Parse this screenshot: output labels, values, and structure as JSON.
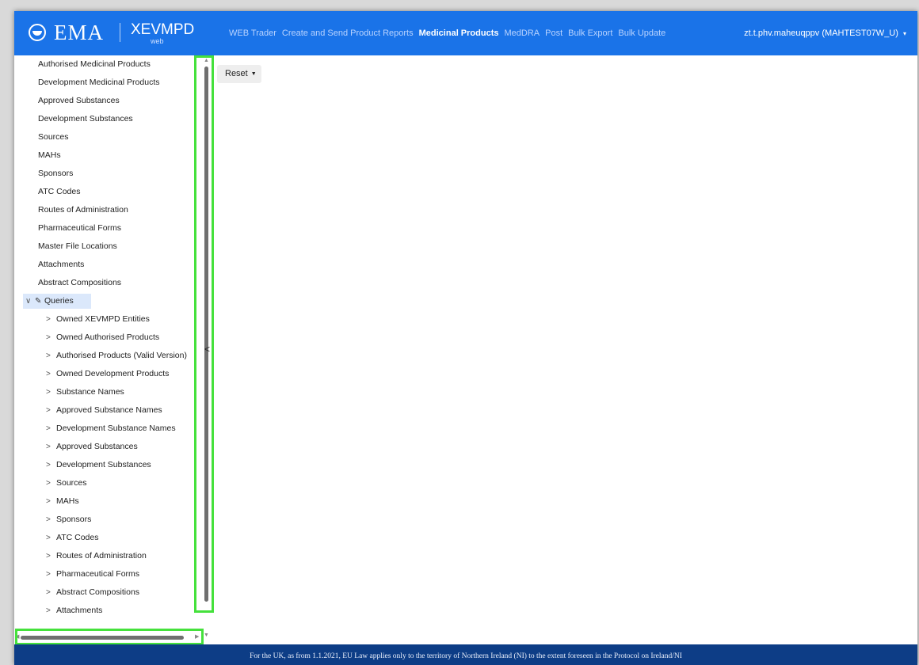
{
  "header": {
    "logo_text": "EMA",
    "app_name": "XEVMPD",
    "app_sub": "web",
    "nav": [
      {
        "label": "WEB Trader",
        "active": false
      },
      {
        "label": "Create and Send Product Reports",
        "active": false
      },
      {
        "label": "Medicinal Products",
        "active": true
      },
      {
        "label": "MedDRA",
        "active": false
      },
      {
        "label": "Post",
        "active": false
      },
      {
        "label": "Bulk Export",
        "active": false
      },
      {
        "label": "Bulk Update",
        "active": false
      }
    ],
    "user": "zt.t.phv.maheuqppv (MAHTEST07W_U)",
    "user_caret": "▾"
  },
  "sidebar": {
    "top_items": [
      "Authorised Medicinal Products",
      "Development Medicinal Products",
      "Approved Substances",
      "Development Substances",
      "Sources",
      "MAHs",
      "Sponsors",
      "ATC Codes",
      "Routes of Administration",
      "Pharmaceutical Forms",
      "Master File Locations",
      "Attachments",
      "Abstract Compositions"
    ],
    "queries": {
      "label": "Queries",
      "expand_icon": "∨",
      "edit_icon": "✎",
      "children": [
        "Owned XEVMPD Entities",
        "Owned Authorised Products",
        "Authorised Products (Valid Version)",
        "Owned Development Products",
        "Substance Names",
        "Approved Substance Names",
        "Development Substance Names",
        "Approved Substances",
        "Development Substances",
        "Sources",
        "MAHs",
        "Sponsors",
        "ATC Codes",
        "Routes of Administration",
        "Pharmaceutical Forms",
        "Abstract Compositions",
        "Attachments"
      ],
      "child_chevron": ">"
    }
  },
  "toolbar": {
    "reset_label": "Reset",
    "reset_caret": "▼"
  },
  "scroll": {
    "up": "▲",
    "down": "▼",
    "left": "◀",
    "right": "▶",
    "collapse": "<"
  },
  "footer": {
    "text": "For the UK, as from 1.1.2021, EU Law applies only to the territory of Northern Ireland (NI) to the extent foreseen in the Protocol on Ireland/NI"
  },
  "colors": {
    "header_bg": "#1a73e8",
    "footer_bg": "#0d3d86",
    "highlight": "#45e13c"
  }
}
